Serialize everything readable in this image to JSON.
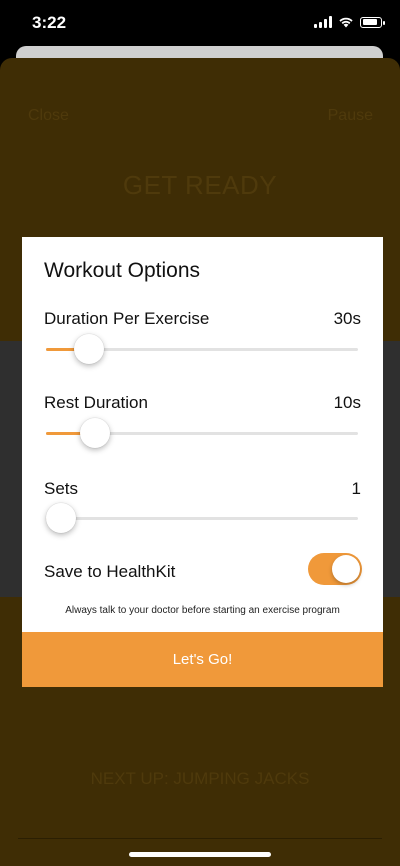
{
  "status_bar": {
    "time": "3:22",
    "icons": [
      "cellular-signal-icon",
      "wifi-icon",
      "battery-icon"
    ]
  },
  "background": {
    "close_label": "Close",
    "pause_label": "Pause",
    "title": "GET READY",
    "next_up": "NEXT UP: JUMPING JACKS"
  },
  "dialog": {
    "title": "Workout Options",
    "duration": {
      "label": "Duration Per Exercise",
      "value": "30s",
      "slider_fraction": 0.1
    },
    "rest": {
      "label": "Rest Duration",
      "value": "10s",
      "slider_fraction": 0.12
    },
    "sets": {
      "label": "Sets",
      "value": "1",
      "slider_fraction": 0.0
    },
    "healthkit": {
      "label": "Save to HealthKit",
      "enabled": true
    },
    "disclaimer": "Always talk to your doctor before starting an exercise program",
    "button_label": "Let's Go!"
  },
  "colors": {
    "accent": "#f0993a",
    "backdrop": "#3f2d05",
    "band": "#2f2f2f"
  }
}
